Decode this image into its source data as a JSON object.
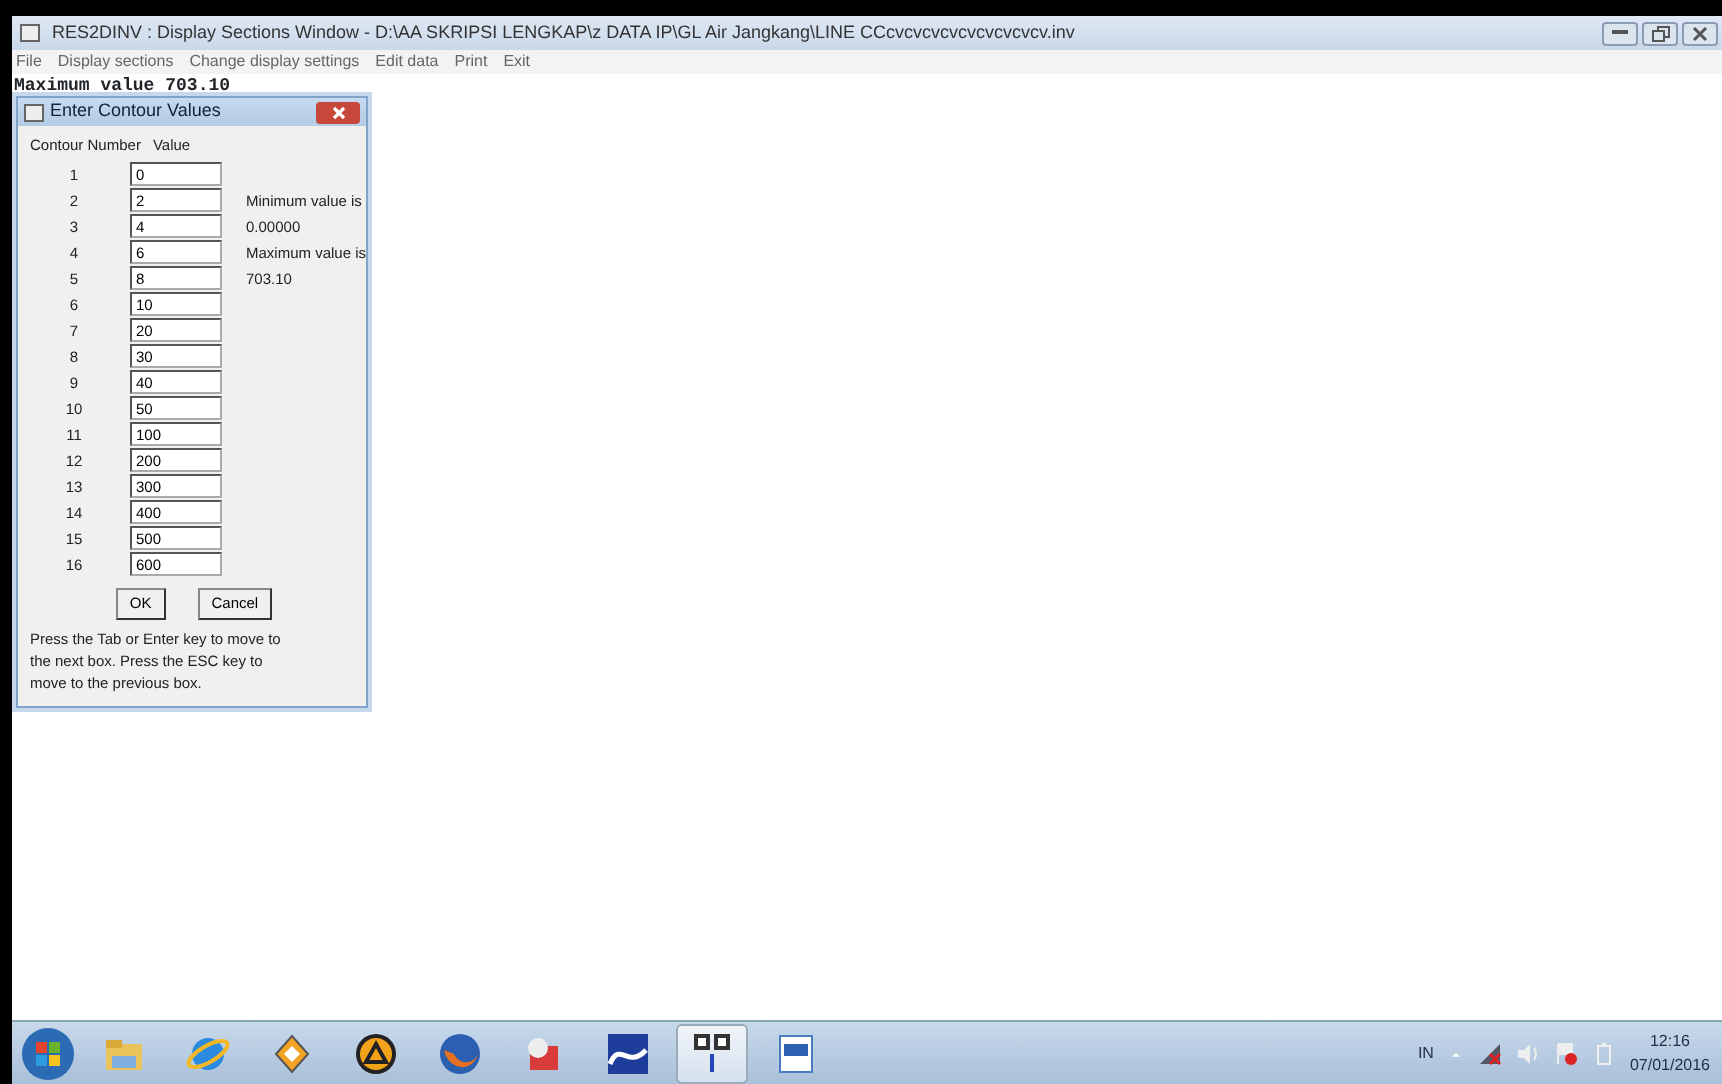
{
  "window": {
    "title": "RES2DINV : Display Sections Window - D:\\AA SKRIPSI LENGKAP\\z DATA IP\\GL Air Jangkang\\LINE CCcvcvcvcvcvcvcvcvcv.inv"
  },
  "menu": [
    "File",
    "Display sections",
    "Change display settings",
    "Edit data",
    "Print",
    "Exit"
  ],
  "background_text": "Maximum value 703.10",
  "dialog": {
    "title": "Enter Contour Values",
    "columns": [
      "Contour Number",
      "Value"
    ],
    "rows": [
      {
        "number": "1",
        "value": "0"
      },
      {
        "number": "2",
        "value": "2"
      },
      {
        "number": "3",
        "value": "4"
      },
      {
        "number": "4",
        "value": "6"
      },
      {
        "number": "5",
        "value": "8"
      },
      {
        "number": "6",
        "value": "10"
      },
      {
        "number": "7",
        "value": "20"
      },
      {
        "number": "8",
        "value": "30"
      },
      {
        "number": "9",
        "value": "40"
      },
      {
        "number": "10",
        "value": "50"
      },
      {
        "number": "11",
        "value": "100"
      },
      {
        "number": "12",
        "value": "200"
      },
      {
        "number": "13",
        "value": "300"
      },
      {
        "number": "14",
        "value": "400"
      },
      {
        "number": "15",
        "value": "500"
      },
      {
        "number": "16",
        "value": "600"
      }
    ],
    "info": [
      "Minimum value is",
      "0.00000",
      "Maximum value is",
      "703.10"
    ],
    "buttons": [
      "OK",
      "Cancel"
    ],
    "help": "Press the Tab or Enter key to move to the next box. Press the ESC key to move to the previous box."
  },
  "taskbar": {
    "apps": [
      {
        "kind": "folder",
        "selected": false
      },
      {
        "kind": "browser",
        "selected": false
      },
      {
        "kind": "player",
        "selected": false
      },
      {
        "kind": "triangle",
        "selected": false
      },
      {
        "kind": "globe",
        "selected": false
      },
      {
        "kind": "cube",
        "selected": false
      },
      {
        "kind": "wave",
        "selected": false
      },
      {
        "kind": "res",
        "selected": true
      },
      {
        "kind": "document",
        "selected": false
      }
    ],
    "language": "IN",
    "time": "12:16",
    "date": "07/01/2016"
  }
}
